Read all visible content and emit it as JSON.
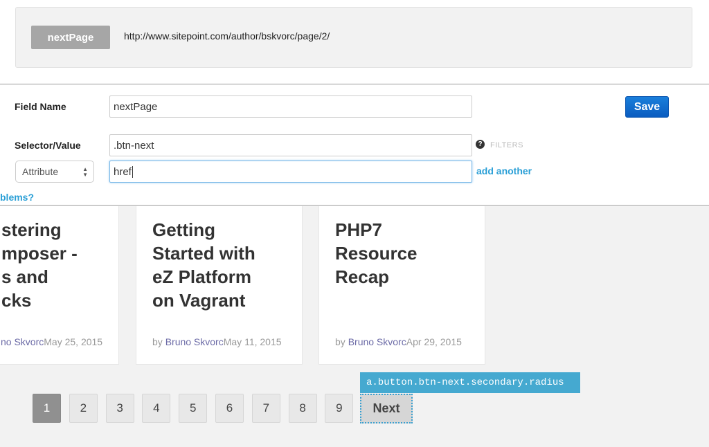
{
  "preview": {
    "field_badge": "nextPage",
    "url": "http://www.sitepoint.com/author/bskvorc/page/2/"
  },
  "form": {
    "field_name_label": "Field Name",
    "field_name_value": "nextPage",
    "save_label": "Save",
    "selector_label": "Selector/Value",
    "selector_value": ".btn-next",
    "help_icon": "question-circle-icon",
    "filters_label": "FILTERS",
    "attribute_select": "Attribute",
    "attribute_value": "href",
    "add_another": "add another",
    "problems_link": "blems?"
  },
  "cards": [
    {
      "title_lines": [
        "stering",
        "mposer -",
        "s and",
        "cks"
      ],
      "by": "",
      "author": "no Skvorc",
      "date": "May 25, 2015"
    },
    {
      "title_lines": [
        "Getting",
        "Started with",
        "eZ Platform",
        "on Vagrant"
      ],
      "by": "by ",
      "author": "Bruno Skvorc",
      "date": "May 11, 2015"
    },
    {
      "title_lines": [
        "PHP7",
        "Resource",
        "Recap",
        ""
      ],
      "by": "by ",
      "author": "Bruno Skvorc",
      "date": "Apr 29, 2015"
    }
  ],
  "pagination": {
    "pages": [
      "1",
      "2",
      "3",
      "4",
      "5",
      "6",
      "7",
      "8",
      "9"
    ],
    "active": "1",
    "next_label": "Next"
  },
  "tooltip": "a.button.btn-next.secondary.radius",
  "colors": {
    "accent": "#2a9fd6",
    "save": "#0a6fd0",
    "tooltip": "#45a9d0"
  }
}
